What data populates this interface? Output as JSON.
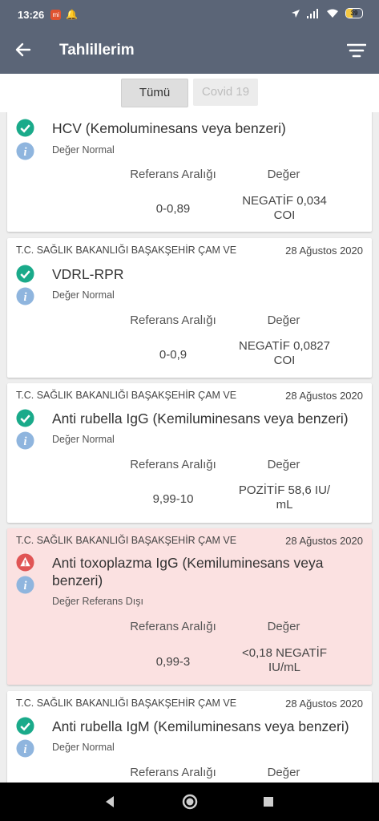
{
  "status_bar": {
    "time": "13:26",
    "mi": "mi",
    "battery": "39",
    "battery_fraction": 0.39
  },
  "app_bar": {
    "title": "Tahlillerim",
    "back_icon": "arrow-left-icon",
    "filter_icon": "filter-lines-icon"
  },
  "filters": {
    "all": "Tümü",
    "covid": "Covid 19"
  },
  "colors": {
    "app_bar": "#5b6577",
    "ok": "#1aaa8a",
    "info": "#8fb5de",
    "alert": "#e05555",
    "alert_bg": "#fbe1e1",
    "selected_chip": "#dedede"
  },
  "ref_header": "Referans Aralığı",
  "val_header": "Değer",
  "results": [
    {
      "org": "",
      "date": "",
      "name": "HCV (Kemoluminesans veya benzeri)",
      "status": "Değer Normal",
      "ref": "0-0,89",
      "value1": "NEGATİF 0,034",
      "value2": "COI",
      "alert": false
    },
    {
      "org": "T.C. SAĞLIK BAKANLIĞI BAŞAKŞEHİR ÇAM VE",
      "date": "28 Ağustos 2020",
      "name": "VDRL-RPR",
      "status": "Değer Normal",
      "ref": "0-0,9",
      "value1": "NEGATİF 0,0827",
      "value2": "COI",
      "alert": false
    },
    {
      "org": "T.C. SAĞLIK BAKANLIĞI BAŞAKŞEHİR ÇAM VE",
      "date": "28 Ağustos 2020",
      "name": "Anti rubella IgG (Kemiluminesans veya benzeri)",
      "status": "Değer Normal",
      "ref": "9,99-10",
      "value1": "POZİTİF 58,6 IU/",
      "value2": "mL",
      "alert": false
    },
    {
      "org": "T.C. SAĞLIK BAKANLIĞI BAŞAKŞEHİR ÇAM VE",
      "date": "28 Ağustos 2020",
      "name": "Anti toxoplazma IgG (Kemiluminesans veya benzeri)",
      "status": "Değer Referans Dışı",
      "ref": "0,99-3",
      "value1": "<0,18 NEGATİF",
      "value2": "IU/mL",
      "alert": true
    },
    {
      "org": "T.C. SAĞLIK BAKANLIĞI BAŞAKŞEHİR ÇAM VE",
      "date": "28 Ağustos 2020",
      "name": "Anti rubella IgM (Kemiluminesans veya benzeri)",
      "status": "Değer Normal",
      "ref": "",
      "value1": "",
      "value2": "",
      "alert": false
    }
  ]
}
